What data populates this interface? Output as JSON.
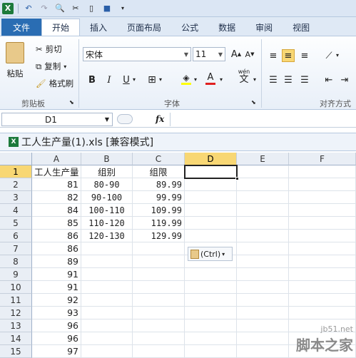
{
  "qat": {
    "icons": [
      "excel-logo",
      "undo",
      "redo",
      "print-preview",
      "cut",
      "new",
      "save",
      "customize"
    ]
  },
  "tabs": [
    {
      "label": "文件",
      "type": "file"
    },
    {
      "label": "开始",
      "type": "active"
    },
    {
      "label": "插入"
    },
    {
      "label": "页面布局"
    },
    {
      "label": "公式"
    },
    {
      "label": "数据"
    },
    {
      "label": "审阅"
    },
    {
      "label": "视图"
    }
  ],
  "ribbon": {
    "paste": "粘贴",
    "cut": "剪切",
    "copy": "复制",
    "format_painter": "格式刷",
    "clipboard": "剪贴板",
    "font_name": "宋体",
    "font_size": "11",
    "font_group": "字体",
    "align_group": "对齐方式",
    "bold": "B",
    "italic": "I",
    "underline": "U",
    "font_color_letter": "A",
    "phonetic": "wén",
    "phonetic_char": "文",
    "grow": "A",
    "shrink": "A"
  },
  "formula_bar": {
    "name_box": "D1",
    "fx": "fx",
    "value": ""
  },
  "workbook": {
    "title": "工人生产量(1).xls  [兼容模式]"
  },
  "sheet": {
    "columns": [
      "A",
      "B",
      "C",
      "D",
      "E",
      "F"
    ],
    "selected_column": "D",
    "selected_row": "1",
    "row_numbers": [
      "1",
      "2",
      "3",
      "4",
      "5",
      "6",
      "7",
      "8",
      "9",
      "10",
      "11",
      "12",
      "13",
      "14",
      "15"
    ],
    "rows": [
      [
        "工人生产量",
        "组别",
        "组限",
        "",
        "",
        ""
      ],
      [
        "81",
        "80-90",
        "89.99",
        "",
        "",
        ""
      ],
      [
        "82",
        "90-100",
        "99.99",
        "",
        "",
        ""
      ],
      [
        "84",
        "100-110",
        "109.99",
        "",
        "",
        ""
      ],
      [
        "85",
        "110-120",
        "119.99",
        "",
        "",
        ""
      ],
      [
        "86",
        "120-130",
        "129.99",
        "",
        "",
        ""
      ],
      [
        "86",
        "",
        "",
        "",
        "",
        ""
      ],
      [
        "89",
        "",
        "",
        "",
        "",
        ""
      ],
      [
        "91",
        "",
        "",
        "",
        "",
        ""
      ],
      [
        "91",
        "",
        "",
        "",
        "",
        ""
      ],
      [
        "92",
        "",
        "",
        "",
        "",
        ""
      ],
      [
        "93",
        "",
        "",
        "",
        "",
        ""
      ],
      [
        "96",
        "",
        "",
        "",
        "",
        ""
      ],
      [
        "96",
        "",
        "",
        "",
        "",
        ""
      ],
      [
        "97",
        "",
        "",
        "",
        "",
        ""
      ]
    ]
  },
  "paste_options": {
    "label": "(Ctrl)"
  },
  "watermark": {
    "line1": "jb51.net",
    "line2": "脚本之家"
  },
  "colors": {
    "accent": "#2a6db3",
    "selection": "#f8d774",
    "excel": "#1d7a3b"
  }
}
